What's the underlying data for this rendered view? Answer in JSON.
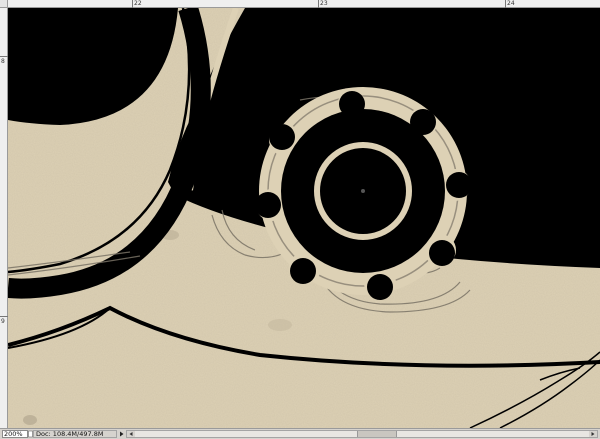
{
  "ruler": {
    "top_labels": [
      "22",
      "23",
      "24"
    ],
    "left_labels": [
      "8",
      "9"
    ]
  },
  "status": {
    "zoom": "200%",
    "doc_info": "Doc: 108.4M/497.8M"
  },
  "icons": {
    "doc-status": "page-icon",
    "status-menu": "triangle-right-icon",
    "scroll-left": "triangle-left-icon",
    "scroll-right": "triangle-right-icon"
  },
  "colors": {
    "paper": "#ddd1b5",
    "ink": "#000000",
    "sketch": "#7a7366",
    "ui_gray": "#d6d3ce"
  }
}
